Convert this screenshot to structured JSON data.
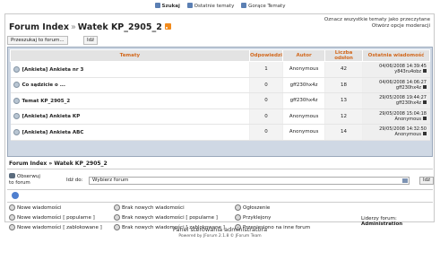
{
  "topnav": [
    {
      "label": "Szukaj",
      "icon": "search-icon"
    },
    {
      "label": "Ostatnie tematy",
      "icon": "recent-topics-icon"
    },
    {
      "label": "Gorące Tematy",
      "icon": "hot-topics-icon"
    }
  ],
  "header": {
    "forum_index": "Forum Index",
    "sep": "»",
    "topic_title": "Watek KP_2905_2",
    "mark_read": "Oznacz wszystkie tematy jako przeczytane",
    "open_mod": "Otwórz opcje moderacji"
  },
  "toolbar": {
    "jump_label": "Przeszukaj to forum...",
    "go_label": "Idź"
  },
  "table": {
    "headers": [
      "Tematy",
      "Odpowiedzi",
      "Autor",
      "Liczba odsłon",
      "Ostatnia wiadomość"
    ],
    "rows": [
      {
        "title": "[Ankieta] Ankieta nr 3",
        "replies": "1",
        "author": "Anonymous",
        "views": "42",
        "last_date": "04/06/2008 14:39:45",
        "last_user": "y843ru4obz"
      },
      {
        "title": "Co sądzicie o ...",
        "replies": "0",
        "author": "gff230hx4z",
        "views": "18",
        "last_date": "04/06/2008 14:06:27",
        "last_user": "gff230hx4z"
      },
      {
        "title": "Temat KP_2905_2",
        "replies": "0",
        "author": "gff230hx4z",
        "views": "13",
        "last_date": "29/05/2008 19:44:27",
        "last_user": "gff230hx4z"
      },
      {
        "title": "[Ankieta] Ankieta KP",
        "replies": "0",
        "author": "Anonymous",
        "views": "12",
        "last_date": "29/05/2008 15:04:18",
        "last_user": "Anonymous"
      },
      {
        "title": "[Ankieta] Ankieta ABC",
        "replies": "0",
        "author": "Anonymous",
        "views": "14",
        "last_date": "29/05/2008 14:32:50",
        "last_user": "Anonymous"
      }
    ]
  },
  "breadcrumb": "Forum Index » Watek KP_2905_2",
  "watch": "Obserwuj to forum",
  "goto": {
    "label": "Idź do:",
    "selected": "Wybierz forum",
    "button": "Idź"
  },
  "legend": {
    "col1": [
      "Nowe wiadomości",
      "Nowe wiadomości [ popularne ]",
      "Nowe wiadomości [ zablokowane ]"
    ],
    "col2": [
      "Brak nowych wiadomości",
      "Brak nowych wiadomości [ popularne ]",
      "Brak nowych wiadomości [ zablokowane ]"
    ],
    "col3": [
      "Ogłoszenie",
      "Przyklejony",
      "Przeniesiono na inne forum"
    ]
  },
  "moderators_label": "Liderzy forum:",
  "moderators_value": "Administration",
  "footer": {
    "panel": "Panel sterowania administratora",
    "powered": "Powered by JForum 2.1.8 © JForum Team"
  }
}
